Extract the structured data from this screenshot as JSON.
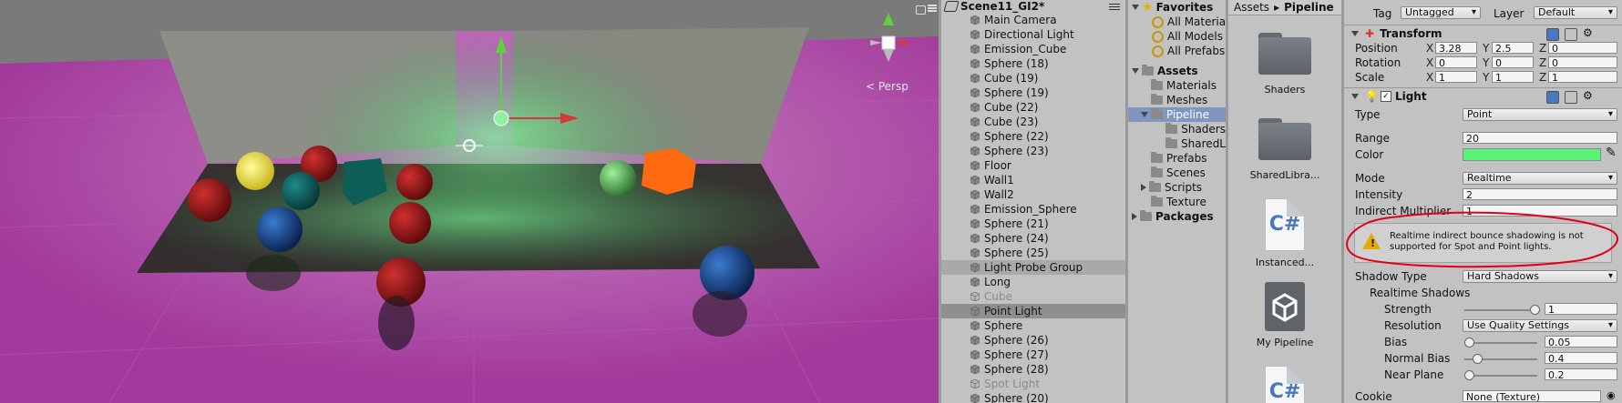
{
  "scene": {
    "persp_label": "< Persp",
    "gizmo_axis": "y"
  },
  "hierarchy": {
    "title": "Scene11_GI2*",
    "items": [
      {
        "label": "Main Camera",
        "state": "normal"
      },
      {
        "label": "Directional Light",
        "state": "normal"
      },
      {
        "label": "Emission_Cube",
        "state": "normal"
      },
      {
        "label": "Sphere (18)",
        "state": "normal"
      },
      {
        "label": "Cube (19)",
        "state": "normal"
      },
      {
        "label": "Sphere (19)",
        "state": "normal"
      },
      {
        "label": "Cube (22)",
        "state": "normal"
      },
      {
        "label": "Cube (23)",
        "state": "normal"
      },
      {
        "label": "Sphere (22)",
        "state": "normal"
      },
      {
        "label": "Sphere (23)",
        "state": "normal"
      },
      {
        "label": "Floor",
        "state": "normal"
      },
      {
        "label": "Wall1",
        "state": "normal"
      },
      {
        "label": "Wall2",
        "state": "normal"
      },
      {
        "label": "Emission_Sphere",
        "state": "normal"
      },
      {
        "label": "Sphere (21)",
        "state": "normal"
      },
      {
        "label": "Sphere (24)",
        "state": "normal"
      },
      {
        "label": "Sphere (25)",
        "state": "normal"
      },
      {
        "label": "Light Probe Group",
        "state": "hover"
      },
      {
        "label": "Long",
        "state": "normal"
      },
      {
        "label": "Cube",
        "state": "dim"
      },
      {
        "label": "Point Light",
        "state": "selected"
      },
      {
        "label": "Sphere",
        "state": "normal"
      },
      {
        "label": "Sphere (26)",
        "state": "normal"
      },
      {
        "label": "Sphere (27)",
        "state": "normal"
      },
      {
        "label": "Sphere (28)",
        "state": "normal"
      },
      {
        "label": "Spot Light",
        "state": "dim"
      },
      {
        "label": "Sphere (20)",
        "state": "normal"
      }
    ]
  },
  "project": {
    "favorites_label": "Favorites",
    "favorites": [
      "All Materia",
      "All Models",
      "All Prefabs"
    ],
    "assets_label": "Assets",
    "folders": [
      {
        "label": "Materials",
        "indent": 1,
        "arrow": "none",
        "selected": false
      },
      {
        "label": "Meshes",
        "indent": 1,
        "arrow": "none",
        "selected": false
      },
      {
        "label": "Pipeline",
        "indent": 1,
        "arrow": "down",
        "selected": true
      },
      {
        "label": "Shaders",
        "indent": 2,
        "arrow": "none",
        "selected": false
      },
      {
        "label": "SharedL",
        "indent": 2,
        "arrow": "none",
        "selected": false
      },
      {
        "label": "Prefabs",
        "indent": 1,
        "arrow": "none",
        "selected": false
      },
      {
        "label": "Scenes",
        "indent": 1,
        "arrow": "none",
        "selected": false
      },
      {
        "label": "Scripts",
        "indent": 1,
        "arrow": "right",
        "selected": false
      },
      {
        "label": "Texture",
        "indent": 1,
        "arrow": "none",
        "selected": false
      }
    ],
    "packages_label": "Packages"
  },
  "assets": {
    "breadcrumb": [
      "Assets",
      "Pipeline"
    ],
    "items": [
      {
        "label": "Shaders",
        "kind": "folder"
      },
      {
        "label": "SharedLibra...",
        "kind": "folder"
      },
      {
        "label": "Instanced...",
        "kind": "cs"
      },
      {
        "label": "My Pipeline",
        "kind": "unity"
      },
      {
        "label": "",
        "kind": "cs"
      }
    ]
  },
  "inspector": {
    "tag_label": "Tag",
    "tag_value": "Untagged",
    "layer_label": "Layer",
    "layer_value": "Default",
    "transform": {
      "title": "Transform",
      "position_label": "Position",
      "position": {
        "x": "3.28",
        "y": "2.5",
        "z": "0"
      },
      "rotation_label": "Rotation",
      "rotation": {
        "x": "0",
        "y": "0",
        "z": "0"
      },
      "scale_label": "Scale",
      "scale": {
        "x": "1",
        "y": "1",
        "z": "1"
      },
      "axis_x": "X",
      "axis_y": "Y",
      "axis_z": "Z"
    },
    "light": {
      "title": "Light",
      "type_label": "Type",
      "type_value": "Point",
      "range_label": "Range",
      "range_value": "20",
      "color_label": "Color",
      "color_hex": "#5cf27a",
      "mode_label": "Mode",
      "mode_value": "Realtime",
      "intensity_label": "Intensity",
      "intensity_value": "2",
      "indirect_label": "Indirect Multiplier",
      "indirect_value": "1",
      "warning": "Realtime indirect bounce shadowing is not supported for Spot and Point lights.",
      "shadow_type_label": "Shadow Type",
      "shadow_type_value": "Hard Shadows",
      "realtime_shadows_label": "Realtime Shadows",
      "strength_label": "Strength",
      "strength_value": "1",
      "strength_level": 1.0,
      "resolution_label": "Resolution",
      "resolution_value": "Use Quality Settings",
      "bias_label": "Bias",
      "bias_value": "0.05",
      "bias_level": 0.0,
      "normal_bias_label": "Normal Bias",
      "normal_bias_value": "0.4",
      "normal_bias_level": 0.13,
      "near_plane_label": "Near Plane",
      "near_plane_value": "0.2",
      "near_plane_level": 0.0,
      "cookie_label": "Cookie",
      "cookie_value": "None (Texture)"
    }
  },
  "colors": {
    "annotation": "#e0001a",
    "selection": "#8f8f8f",
    "folder_selected": "#7f96c0"
  }
}
